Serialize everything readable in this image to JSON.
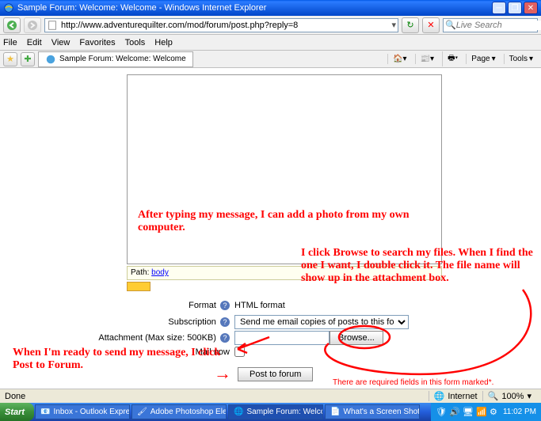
{
  "window": {
    "title": "Sample Forum: Welcome: Welcome - Windows Internet Explorer"
  },
  "nav": {
    "url": "http://www.adventurequilter.com/mod/forum/post.php?reply=8",
    "search_placeholder": "Live Search"
  },
  "menu": {
    "file": "File",
    "edit": "Edit",
    "view": "View",
    "favorites": "Favorites",
    "tools": "Tools",
    "help": "Help"
  },
  "tab": {
    "title": "Sample Forum: Welcome: Welcome"
  },
  "toolbar": {
    "home": "",
    "print": "",
    "page": "Page",
    "tools": "Tools"
  },
  "editor": {
    "path_label": "Path:",
    "path_value": "body"
  },
  "form": {
    "format_label": "Format",
    "format_value": "HTML format",
    "subscription_label": "Subscription",
    "subscription_value": "Send me email copies of posts to this forum",
    "attachment_label": "Attachment (Max size: 500KB)",
    "browse_label": "Browse...",
    "mailnow_label": "Mail now",
    "post_label": "Post to forum",
    "required_text": "There are required fields in this form marked",
    "asterisk": "*"
  },
  "annotations": {
    "a1": "After typing my message, I can add a photo from my own computer.",
    "a2": "I click Browse to search my files.  When I find the one I want, I double click it.  The file name will show up in the attachment box.",
    "a3": "When I'm ready to send my message, I click Post to Forum."
  },
  "status": {
    "done": "Done",
    "zone": "Internet",
    "zoom": "100%"
  },
  "taskbar": {
    "start": "Start",
    "items": [
      "Inbox - Outlook Express",
      "Adobe Photoshop Elements",
      "Sample Forum: Welco...",
      "What's a Screen Shot, a..."
    ],
    "clock": "11:02 PM"
  }
}
